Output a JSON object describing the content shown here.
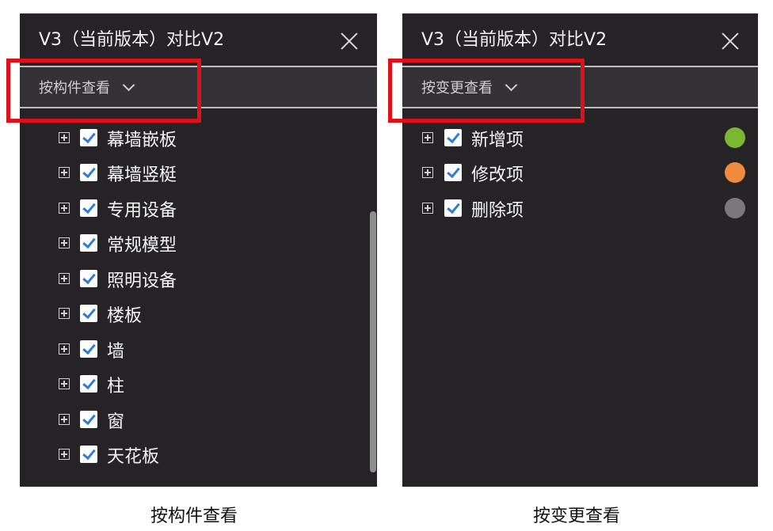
{
  "left_panel": {
    "title": "V3（当前版本）对比V2",
    "close_icon": "close-icon",
    "view_mode": "按构件查看",
    "items": [
      {
        "label": "幕墙嵌板",
        "checked": true
      },
      {
        "label": "幕墙竖梃",
        "checked": true
      },
      {
        "label": "专用设备",
        "checked": true
      },
      {
        "label": "常规模型",
        "checked": true
      },
      {
        "label": "照明设备",
        "checked": true
      },
      {
        "label": "楼板",
        "checked": true
      },
      {
        "label": "墙",
        "checked": true
      },
      {
        "label": "柱",
        "checked": true
      },
      {
        "label": "窗",
        "checked": true
      },
      {
        "label": "天花板",
        "checked": true
      }
    ]
  },
  "right_panel": {
    "title": "V3（当前版本）对比V2",
    "close_icon": "close-icon",
    "view_mode": "按变更查看",
    "items": [
      {
        "label": "新增项",
        "checked": true,
        "color": "#7cb82f"
      },
      {
        "label": "修改项",
        "checked": true,
        "color": "#f08a3c"
      },
      {
        "label": "删除项",
        "checked": true,
        "color": "#7a787c"
      }
    ]
  },
  "captions": {
    "left": "按构件查看",
    "right": "按变更查看"
  },
  "colors": {
    "panel_bg": "#252326",
    "toolbar_bg": "#333135",
    "highlight": "#e0101a",
    "checkbox_check": "#2f7bd8"
  }
}
